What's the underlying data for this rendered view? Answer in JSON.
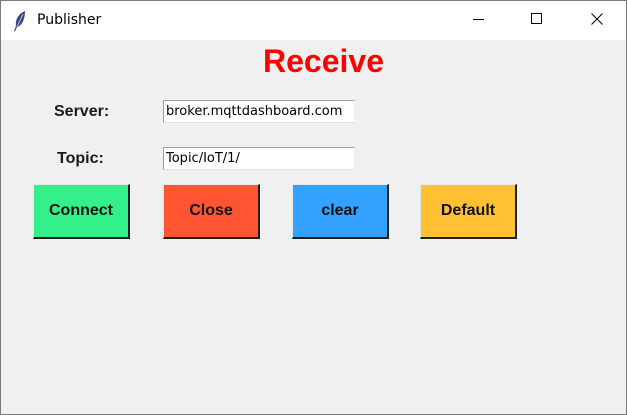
{
  "window": {
    "title": "Publisher",
    "app_icon": "feather-icon",
    "controls": [
      "minimize-icon",
      "maximize-icon",
      "close-icon"
    ]
  },
  "heading": {
    "text": "Receive",
    "color": "#ff0000"
  },
  "form": {
    "server_label": "Server:",
    "server_value": "broker.mqttdashboard.com",
    "topic_label": "Topic:",
    "topic_value": "Topic/IoT/1/"
  },
  "buttons": [
    {
      "label": "Connect",
      "color": "#33f08a"
    },
    {
      "label": "Close",
      "color": "#ff5533"
    },
    {
      "label": "clear",
      "color": "#33a1ff"
    },
    {
      "label": "Default",
      "color": "#ffc133"
    }
  ]
}
